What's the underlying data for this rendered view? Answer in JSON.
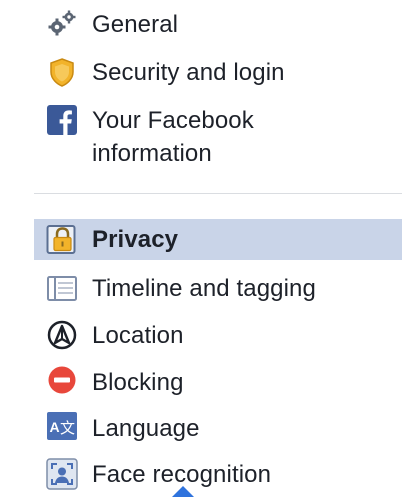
{
  "settings_menu": {
    "general": {
      "label": "General",
      "icon": "gears-icon"
    },
    "security": {
      "label": "Security and login",
      "icon": "badge-icon"
    },
    "your_facebook_info": {
      "label_line1": "Your Facebook",
      "label_line2": "information",
      "icon": "facebook-icon"
    },
    "privacy": {
      "label": "Privacy",
      "icon": "lock-icon",
      "selected": true
    },
    "timeline": {
      "label": "Timeline and tagging",
      "icon": "timeline-icon"
    },
    "location": {
      "label": "Location",
      "icon": "location-icon"
    },
    "blocking": {
      "label": "Blocking",
      "icon": "blocking-icon"
    },
    "language": {
      "label": "Language",
      "icon": "language-icon"
    },
    "face_recognition": {
      "label": "Face recognition",
      "icon": "face-recognition-icon"
    }
  },
  "colors": {
    "selected_background": "#c9d4e8",
    "facebook_blue": "#3b5998",
    "blocking_red": "#e8473b",
    "security_gold": "#f2b32a",
    "tooltip_blue": "#2f73dd",
    "divider": "#dadde1"
  }
}
